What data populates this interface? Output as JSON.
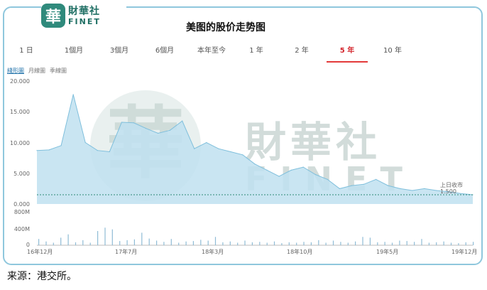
{
  "logo": {
    "mark": "華",
    "cn": "財華社",
    "en": "FINET"
  },
  "title": "美图的股价走势图",
  "tabs": [
    {
      "label": "1 日",
      "active": false
    },
    {
      "label": "1個月",
      "active": false
    },
    {
      "label": "3個月",
      "active": false
    },
    {
      "label": "6個月",
      "active": false
    },
    {
      "label": "本年至今",
      "active": false
    },
    {
      "label": "1 年",
      "active": false
    },
    {
      "label": "2 年",
      "active": false
    },
    {
      "label": "5 年",
      "active": true
    },
    {
      "label": "10 年",
      "active": false
    }
  ],
  "subtabs": [
    {
      "label": "綫形圖",
      "active": true
    },
    {
      "label": "月線圖",
      "active": false
    },
    {
      "label": "季線圖",
      "active": false
    }
  ],
  "watermark": {
    "cn": "財華社",
    "en": "FINET",
    "mark": "華"
  },
  "colors": {
    "accent": "#e33a3a",
    "area_fill": "#bfe0f0",
    "area_line": "#7fbfdc",
    "volume": "#8fbcd6",
    "ref_line": "#2e8a78"
  },
  "chart_data": [
    {
      "type": "area",
      "x": [
        "16年12月",
        "17年1月",
        "17年2月",
        "17年3月",
        "17年4月",
        "17年5月",
        "17年6月",
        "17年7月",
        "17年8月",
        "17年9月",
        "17年10月",
        "17年11月",
        "17年12月",
        "18年1月",
        "18年2月",
        "18年3月",
        "18年4月",
        "18年5月",
        "18年6月",
        "18年7月",
        "18年8月",
        "18年9月",
        "18年10月",
        "18年11月",
        "18年12月",
        "19年1月",
        "19年2月",
        "19年3月",
        "19年4月",
        "19年5月",
        "19年6月",
        "19年7月",
        "19年8月",
        "19年9月",
        "19年10月",
        "19年11月",
        "19年12月"
      ],
      "y": [
        8700,
        8800,
        9500,
        17800,
        10000,
        8700,
        8500,
        13300,
        13200,
        12300,
        11500,
        12000,
        13500,
        9000,
        10000,
        9000,
        8500,
        8000,
        6500,
        5500,
        4500,
        5500,
        6000,
        4800,
        4000,
        2500,
        3000,
        3200,
        4000,
        3000,
        2500,
        2200,
        2500,
        2200,
        2000,
        1700,
        1500
      ],
      "y_ticks": [
        "20.000",
        "15.000",
        "10.000",
        "5.000",
        "0.000"
      ],
      "ylim": [
        0,
        20000
      ],
      "x_ticks": [
        "16年12月",
        "17年7月",
        "18年3月",
        "18年10月",
        "19年5月",
        "19年12月"
      ],
      "reference_label": "上日收市",
      "reference_value": "1.500"
    },
    {
      "type": "bar",
      "y_ticks": [
        "800M",
        "400M",
        "0"
      ],
      "ylim": [
        0,
        800
      ],
      "values": [
        150,
        90,
        60,
        180,
        260,
        70,
        120,
        60,
        340,
        420,
        380,
        100,
        120,
        140,
        300,
        160,
        110,
        80,
        150,
        60,
        90,
        100,
        130,
        110,
        200,
        70,
        90,
        60,
        110,
        70,
        80,
        60,
        90,
        50,
        70,
        60,
        80,
        70,
        120,
        60,
        110,
        80,
        60,
        90,
        200,
        180,
        70,
        80,
        60,
        110,
        100,
        80,
        150,
        60,
        70,
        90,
        60,
        50,
        70,
        80
      ]
    }
  ],
  "footer": {
    "source": "来源：港交所。"
  }
}
